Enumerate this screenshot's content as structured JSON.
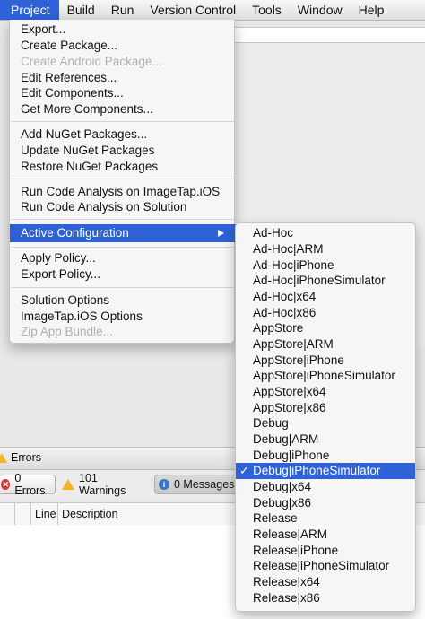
{
  "menubar": {
    "items": [
      "Project",
      "Build",
      "Run",
      "Version Control",
      "Tools",
      "Window",
      "Help"
    ],
    "active_index": 0
  },
  "project_menu": {
    "items": [
      {
        "label": "Export...",
        "enabled": true
      },
      {
        "label": "Create Package...",
        "enabled": true
      },
      {
        "label": "Create Android Package...",
        "enabled": false
      },
      {
        "label": "Edit References...",
        "enabled": true
      },
      {
        "label": "Edit Components...",
        "enabled": true
      },
      {
        "label": "Get More Components...",
        "enabled": true
      },
      {
        "label": "Add NuGet Packages...",
        "enabled": true
      },
      {
        "label": "Update NuGet Packages",
        "enabled": true
      },
      {
        "label": "Restore NuGet Packages",
        "enabled": true
      },
      {
        "label": "Run Code Analysis on ImageTap.iOS",
        "enabled": true
      },
      {
        "label": "Run Code Analysis on Solution",
        "enabled": true
      },
      {
        "label": "Active Configuration",
        "enabled": true,
        "highlighted": true,
        "has_submenu": true
      },
      {
        "label": "Apply Policy...",
        "enabled": true
      },
      {
        "label": "Export Policy...",
        "enabled": true
      },
      {
        "label": "Solution Options",
        "enabled": true
      },
      {
        "label": "ImageTap.iOS Options",
        "enabled": true
      },
      {
        "label": "Zip App Bundle...",
        "enabled": false
      }
    ]
  },
  "configuration_submenu": {
    "items": [
      "Ad-Hoc",
      "Ad-Hoc|ARM",
      "Ad-Hoc|iPhone",
      "Ad-Hoc|iPhoneSimulator",
      "Ad-Hoc|x64",
      "Ad-Hoc|x86",
      "AppStore",
      "AppStore|ARM",
      "AppStore|iPhone",
      "AppStore|iPhoneSimulator",
      "AppStore|x64",
      "AppStore|x86",
      "Debug",
      "Debug|ARM",
      "Debug|iPhone",
      "Debug|iPhoneSimulator",
      "Debug|x64",
      "Debug|x86",
      "Release",
      "Release|ARM",
      "Release|iPhone",
      "Release|iPhoneSimulator",
      "Release|x64",
      "Release|x86"
    ],
    "selected": "Debug|iPhoneSimulator",
    "check_glyph": "✓"
  },
  "errors_pad": {
    "title": "Errors",
    "errors_label": "0 Errors",
    "warnings_label": "101 Warnings",
    "messages_label": "0 Messages",
    "columns": [
      "Line",
      "Description"
    ]
  },
  "colors": {
    "accent": "#2e62d6",
    "warning": "#f1b428",
    "error": "#d9382f",
    "info": "#3a76c6"
  }
}
